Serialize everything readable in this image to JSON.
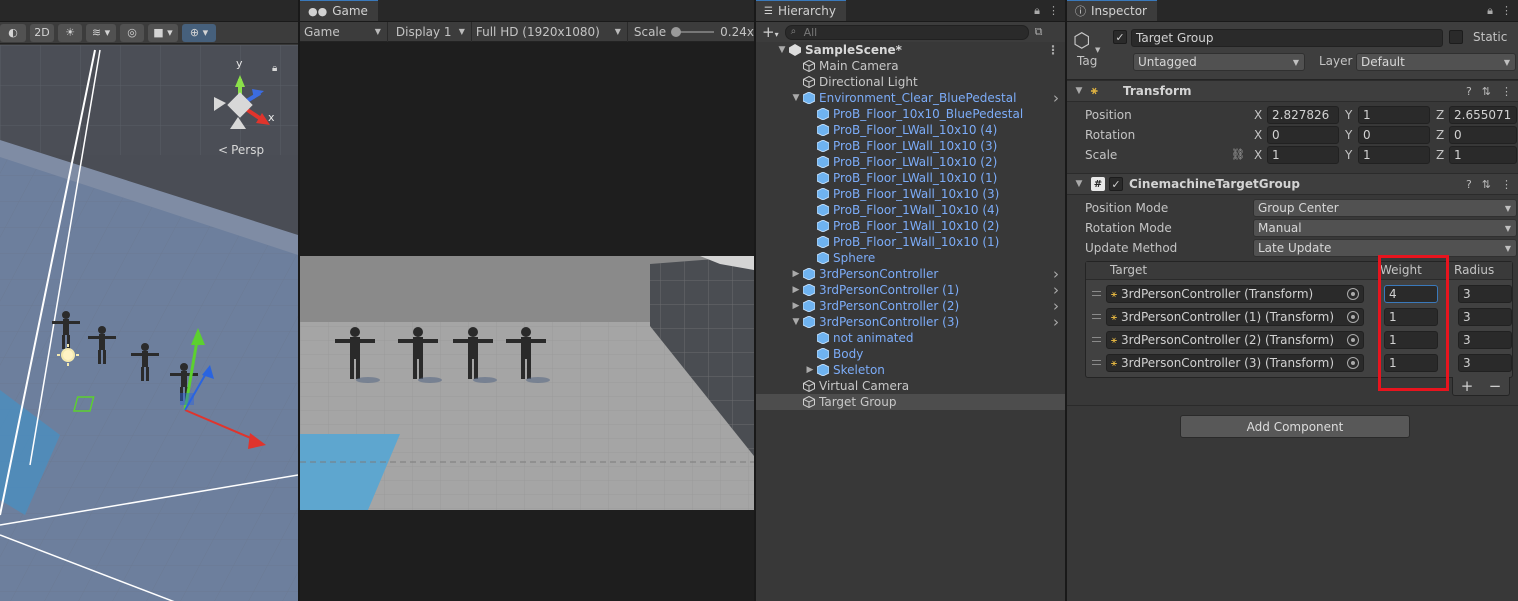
{
  "scene": {
    "tools": {
      "mode_2d": "2D"
    },
    "persp_label": "Persp",
    "gizmo_axes": {
      "x": "x",
      "y": "y"
    }
  },
  "game": {
    "tab_label": "Game",
    "view_dropdown": "Game",
    "display_dropdown": "Display 1",
    "resolution_dropdown": "Full HD (1920x1080)",
    "scale_label": "Scale",
    "scale_value": "0.24x"
  },
  "hierarchy": {
    "tab_label": "Hierarchy",
    "search_placeholder": "All",
    "items": [
      {
        "label": "SampleScene*",
        "indent": 0,
        "type": "scene",
        "arrow": "▼"
      },
      {
        "label": "Main Camera",
        "indent": 1,
        "type": "object",
        "arrow": ""
      },
      {
        "label": "Directional Light",
        "indent": 1,
        "type": "object",
        "arrow": ""
      },
      {
        "label": "Environment_Clear_BluePedestal",
        "indent": 1,
        "type": "prefab",
        "arrow": "▼",
        "chevron": true
      },
      {
        "label": "ProB_Floor_10x10_BluePedestal",
        "indent": 2,
        "type": "prefab",
        "arrow": ""
      },
      {
        "label": "ProB_Floor_LWall_10x10 (4)",
        "indent": 2,
        "type": "prefab",
        "arrow": ""
      },
      {
        "label": "ProB_Floor_LWall_10x10 (3)",
        "indent": 2,
        "type": "prefab",
        "arrow": ""
      },
      {
        "label": "ProB_Floor_LWall_10x10 (2)",
        "indent": 2,
        "type": "prefab",
        "arrow": ""
      },
      {
        "label": "ProB_Floor_LWall_10x10 (1)",
        "indent": 2,
        "type": "prefab",
        "arrow": ""
      },
      {
        "label": "ProB_Floor_1Wall_10x10 (3)",
        "indent": 2,
        "type": "prefab",
        "arrow": ""
      },
      {
        "label": "ProB_Floor_1Wall_10x10 (4)",
        "indent": 2,
        "type": "prefab",
        "arrow": ""
      },
      {
        "label": "ProB_Floor_1Wall_10x10 (2)",
        "indent": 2,
        "type": "prefab",
        "arrow": ""
      },
      {
        "label": "ProB_Floor_1Wall_10x10 (1)",
        "indent": 2,
        "type": "prefab",
        "arrow": ""
      },
      {
        "label": "Sphere",
        "indent": 2,
        "type": "prefab",
        "arrow": ""
      },
      {
        "label": "3rdPersonController",
        "indent": 1,
        "type": "prefab",
        "arrow": "▶",
        "chevron": true
      },
      {
        "label": "3rdPersonController (1)",
        "indent": 1,
        "type": "prefab",
        "arrow": "▶",
        "chevron": true
      },
      {
        "label": "3rdPersonController (2)",
        "indent": 1,
        "type": "prefab",
        "arrow": "▶",
        "chevron": true
      },
      {
        "label": "3rdPersonController (3)",
        "indent": 1,
        "type": "prefab",
        "arrow": "▼",
        "chevron": true
      },
      {
        "label": "not animated",
        "indent": 2,
        "type": "prefab",
        "arrow": ""
      },
      {
        "label": "Body",
        "indent": 2,
        "type": "prefab",
        "arrow": ""
      },
      {
        "label": "Skeleton",
        "indent": 2,
        "type": "prefab",
        "arrow": "▶"
      },
      {
        "label": "Virtual Camera",
        "indent": 1,
        "type": "object",
        "arrow": ""
      },
      {
        "label": "Target Group",
        "indent": 1,
        "type": "object",
        "arrow": "",
        "selected": true
      }
    ]
  },
  "inspector": {
    "tab_label": "Inspector",
    "object_name": "Target Group",
    "static_label": "Static",
    "tag_label": "Tag",
    "tag_value": "Untagged",
    "layer_label": "Layer",
    "layer_value": "Default",
    "transform": {
      "title": "Transform",
      "position_label": "Position",
      "rotation_label": "Rotation",
      "scale_label": "Scale",
      "position": {
        "x": "2.827826",
        "y": "1",
        "z": "2.655071"
      },
      "rotation": {
        "x": "0",
        "y": "0",
        "z": "0"
      },
      "scale": {
        "x": "1",
        "y": "1",
        "z": "1"
      },
      "axis_x": "X",
      "axis_y": "Y",
      "axis_z": "Z"
    },
    "target_group": {
      "title": "CinemachineTargetGroup",
      "position_mode_label": "Position Mode",
      "position_mode_value": "Group Center",
      "rotation_mode_label": "Rotation Mode",
      "rotation_mode_value": "Manual",
      "update_method_label": "Update Method",
      "update_method_value": "Late Update",
      "col_target": "Target",
      "col_weight": "Weight",
      "col_radius": "Radius",
      "targets": [
        {
          "target": "3rdPersonController (Transform)",
          "weight": "4",
          "radius": "3"
        },
        {
          "target": "3rdPersonController (1) (Transform)",
          "weight": "1",
          "radius": "3"
        },
        {
          "target": "3rdPersonController (2) (Transform)",
          "weight": "1",
          "radius": "3"
        },
        {
          "target": "3rdPersonController (3) (Transform)",
          "weight": "1",
          "radius": "3"
        }
      ],
      "add_symbol": "+",
      "remove_symbol": "−"
    },
    "add_component_label": "Add Component"
  },
  "colors": {
    "accent": "#3a79bb",
    "prefab_text": "#7cacf8",
    "highlight_box": "#e8141e"
  }
}
